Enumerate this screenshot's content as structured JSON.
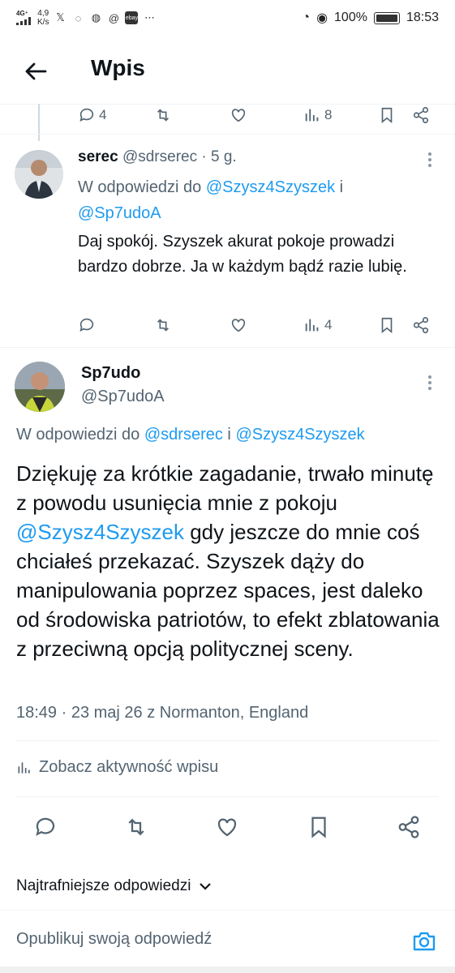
{
  "status_bar": {
    "network": "4G⁺",
    "speed": "4,9",
    "speed_unit": "K/s",
    "battery_percent": "100%",
    "time": "18:53",
    "apps": [
      "x-icon",
      "messenger-icon",
      "messenger-icon",
      "threads-icon",
      "ebay-icon",
      "more-icon"
    ]
  },
  "header": {
    "title": "Wpis"
  },
  "prev_tweet_actions": {
    "replies": "4",
    "views": "8"
  },
  "reply_tweet": {
    "name": "serec",
    "handle_time": "@sdrserec · 5 g.",
    "reply_to_prefix": "W odpowiedzi do ",
    "reply_to_mention1": "@Szysz4Szyszek",
    "reply_to_join": " i ",
    "reply_to_mention2": "@Sp7udoA",
    "text": "Daj spokój. Szyszek akurat pokoje prowadzi bardzo dobrze. Ja w każdym bądź razie lubię.",
    "views": "4"
  },
  "main_tweet": {
    "name": "Sp7udo",
    "handle": "@Sp7udoA",
    "reply_to_prefix": "W odpowiedzi do ",
    "reply_to_mention1": "@sdrserec",
    "reply_to_join": " i ",
    "reply_to_mention2": "@Szysz4Szyszek",
    "text_part1": "Dziękuję za krótkie zagadanie, trwało minutę z powodu usunięcia mnie z pokoju ",
    "text_mention": "@Szysz4Szyszek",
    "text_part2": " gdy jeszcze do mnie coś chciałeś przekazać. Szyszek dąży do manipulowania poprzez spaces, jest daleko od środowiska patriotów, to efekt zblatowania z przeciwną opcją politycznej sceny.",
    "meta": "18:49 · 23 maj 26 z Normanton, England"
  },
  "activity_label": "Zobacz aktywność wpisu",
  "sort_label": "Najtrafniejsze odpowiedzi",
  "compose_placeholder": "Opublikuj swoją odpowiedź",
  "colors": {
    "accent": "#1d9bf0",
    "secondary_text": "#536471",
    "primary_text": "#0f1419"
  }
}
